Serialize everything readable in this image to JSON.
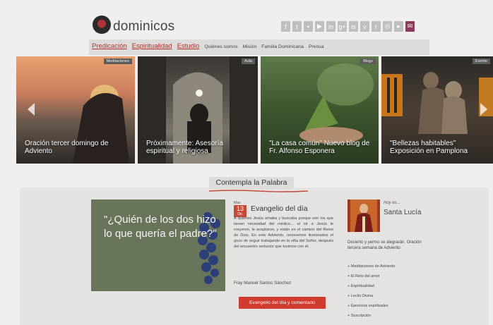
{
  "header": {
    "brand": "dominicos",
    "social_icons": [
      "facebook-icon",
      "twitter-icon",
      "flickr-icon",
      "youtube-icon",
      "linkedin-icon",
      "gplus-icon",
      "issuu-icon",
      "vimeo-icon",
      "rss-icon",
      "instagram-icon",
      "video-icon",
      "mail-icon"
    ],
    "social_glyphs": [
      "f",
      "t",
      "•",
      "▶",
      "in",
      "g+",
      "is",
      "v",
      "r",
      "◎",
      "▸",
      "✉"
    ]
  },
  "nav": {
    "main": [
      "Predicación",
      "Espiritualidad",
      "Estudio"
    ],
    "sub": [
      "Quiénes somos",
      "Misión",
      "Familia Dominicana",
      "Prensa"
    ]
  },
  "slides": [
    {
      "tag": "Meditaciones",
      "caption": "Oración tercer domingo de Adviento"
    },
    {
      "tag": "Aula",
      "caption": "Próximamente: Asesoría espiritual y religiosa"
    },
    {
      "tag": "Blogs",
      "caption": "\"La casa común\" Nuevo blog de Fr. Alfonso Esponera"
    },
    {
      "tag": "Evento",
      "caption": "\"Bellezas habitables\" Exposición en Pamplona"
    }
  ],
  "section": {
    "title": "Contempla la Palabra"
  },
  "quote": {
    "text": "\"¿Quién de los dos hizo lo que quería el padre?\""
  },
  "gospel": {
    "weekday": "Mar",
    "day": "13",
    "month": "Dic",
    "title": "Evangelio del día",
    "body": "A quienes Jesús amaba y buscaba porque son los que tienen necesidad del médico... al oír a Jesús le creyeron, le aceptaron, y están en el camino del Reino de Dios. En este Adviento, renovemos ilusionados el gozo de seguir trabajando en la viña del Señor, después del encuentro seductor que tuvimos con él.",
    "author": "Fray Manuel Santos Sánchez",
    "button": "Evangelio del día y comentario"
  },
  "saint": {
    "kicker": "Hoy es...",
    "name": "Santa Lucía",
    "desc": "Desierto y yermo se alegrarán. Oración tercera semana de Adviento",
    "links": [
      "+ Meditaciones de Adviento",
      "+ El Reto del amor",
      "+ Espiritualidad",
      "+ Lectio Divina",
      "+ Ejercicios espirituales",
      "+ Suscripción"
    ]
  },
  "colors": {
    "accent": "#b1302b",
    "button": "#cf3b2f",
    "band": "#e5e3e2"
  }
}
